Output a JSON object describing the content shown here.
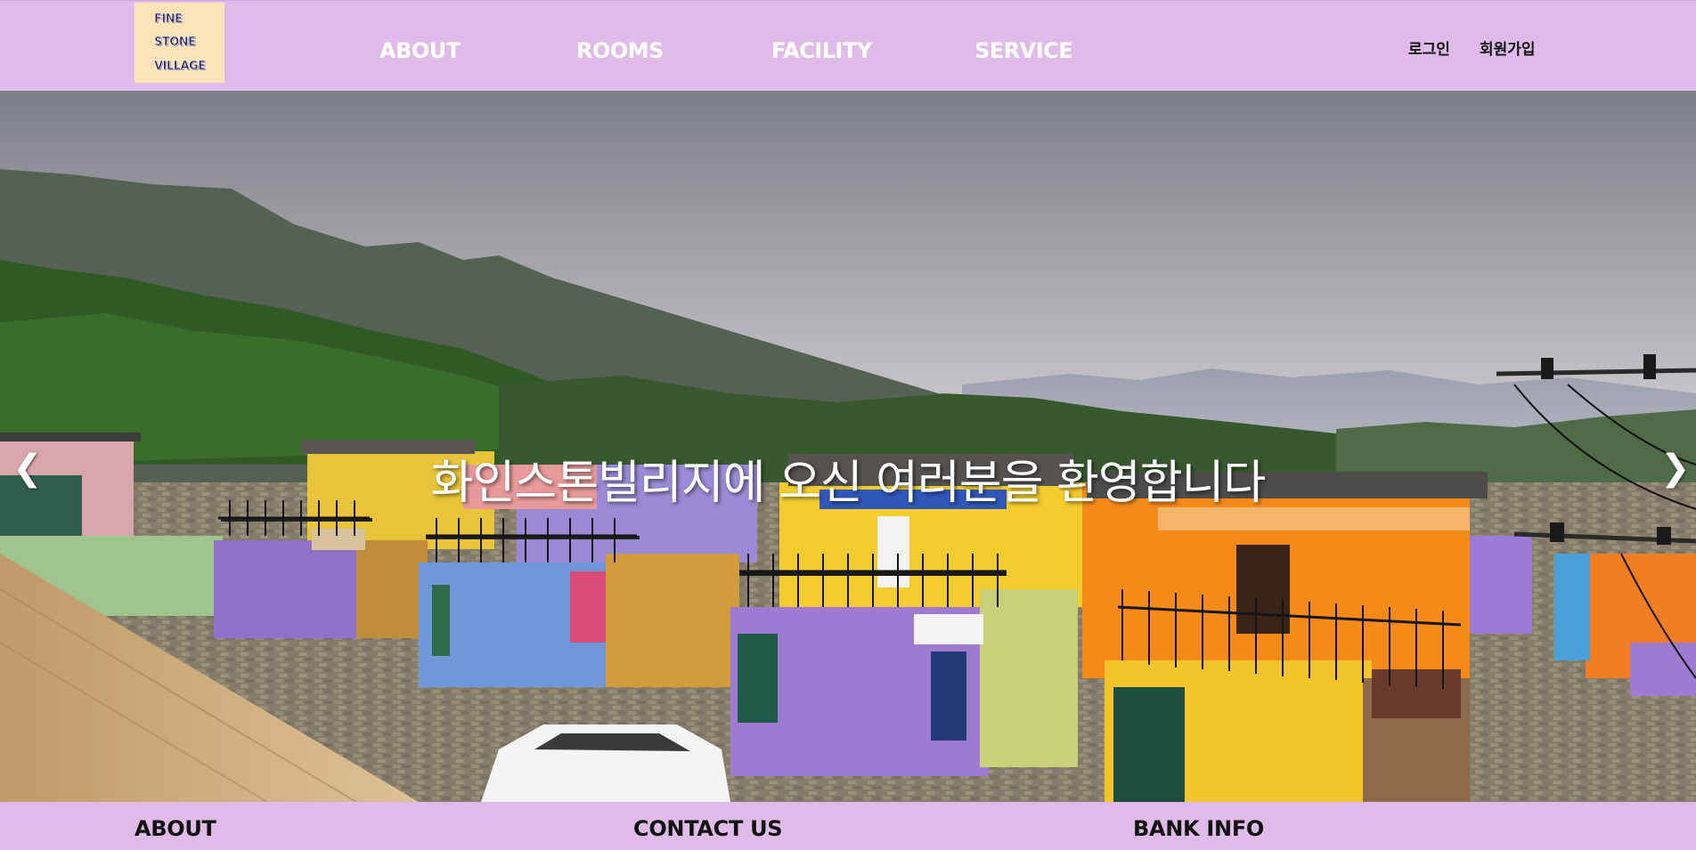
{
  "header": {
    "logo": {
      "lines": [
        "FINE",
        "STONE",
        "VILLAGE"
      ],
      "background": "#fde3b8"
    },
    "nav": [
      {
        "label": "ABOUT"
      },
      {
        "label": "ROOMS"
      },
      {
        "label": "FACILITY"
      },
      {
        "label": "SERVICE"
      }
    ],
    "auth": {
      "login": "로그인",
      "signup": "회원가입"
    },
    "background": "#e0bbea"
  },
  "hero": {
    "caption": "화인스톤빌리지에 오신 여러분을 환영합니다",
    "prev_arrow": "❮",
    "next_arrow": "❯",
    "image_subject": "colorful-container-houses-mountain-valley"
  },
  "footer": {
    "headings": [
      {
        "label": "ABOUT"
      },
      {
        "label": "CONTACT US"
      },
      {
        "label": "BANK INFO"
      }
    ],
    "background": "#e0bbea"
  }
}
